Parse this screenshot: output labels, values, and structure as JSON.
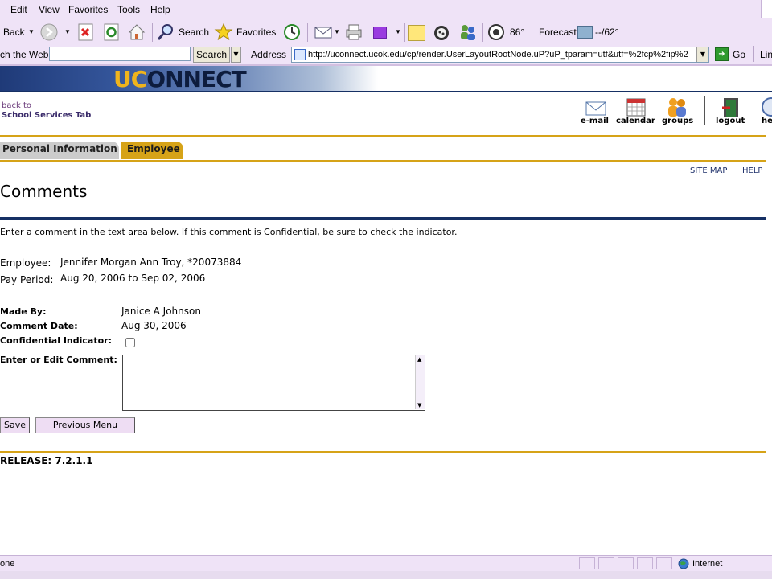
{
  "browser": {
    "menu": [
      "Edit",
      "View",
      "Favorites",
      "Tools",
      "Help"
    ],
    "toolbar": {
      "back_label": "Back",
      "search_label": "Search",
      "favorites_label": "Favorites",
      "weather_temp": "86°",
      "forecast_label": "Forecast",
      "forecast_temp": "--/62°"
    },
    "addressbar": {
      "web_search_label": "ch the Web",
      "web_search_button": "Search",
      "address_label": "Address",
      "url": "http://uconnect.ucok.edu/cp/render.UserLayoutRootNode.uP?uP_tparam=utf&utf=%2fcp%2fip%2",
      "go_label": "Go",
      "links_label": "Lin"
    },
    "status": {
      "text": "one",
      "zone": "Internet"
    }
  },
  "header": {
    "logo_uc": "UC",
    "logo_rest": "ONNECT",
    "back_to": "back to",
    "back_target": "School Services Tab",
    "icons": {
      "email": "e-mail",
      "calendar": "calendar",
      "groups": "groups",
      "logout": "logout",
      "help": "he"
    }
  },
  "tabs": {
    "personal": "Personal Information",
    "employee": "Employee"
  },
  "util_links": {
    "site_map": "SITE MAP",
    "help": "HELP"
  },
  "page": {
    "title": "Comments",
    "instructions": "Enter a comment in the text area below. If this comment is Confidential, be sure to check the indicator.",
    "employee_label": "Employee:",
    "employee_value": "Jennifer Morgan Ann Troy, *20073884",
    "pay_period_label": "Pay Period:",
    "pay_period_value": "Aug 20, 2006 to Sep 02, 2006",
    "made_by_label": "Made By:",
    "made_by_value": "Janice A Johnson",
    "comment_date_label": "Comment Date:",
    "comment_date_value": "Aug 30, 2006",
    "confidential_label": "Confidential Indicator:",
    "confidential_checked": false,
    "comment_label": "Enter or Edit Comment:",
    "comment_value": "",
    "save_button": "Save",
    "previous_button": "Previous Menu",
    "release": "RELEASE: 7.2.1.1"
  },
  "colors": {
    "navy": "#163064",
    "gold": "#d6a318",
    "chrome": "#efe3f7"
  }
}
